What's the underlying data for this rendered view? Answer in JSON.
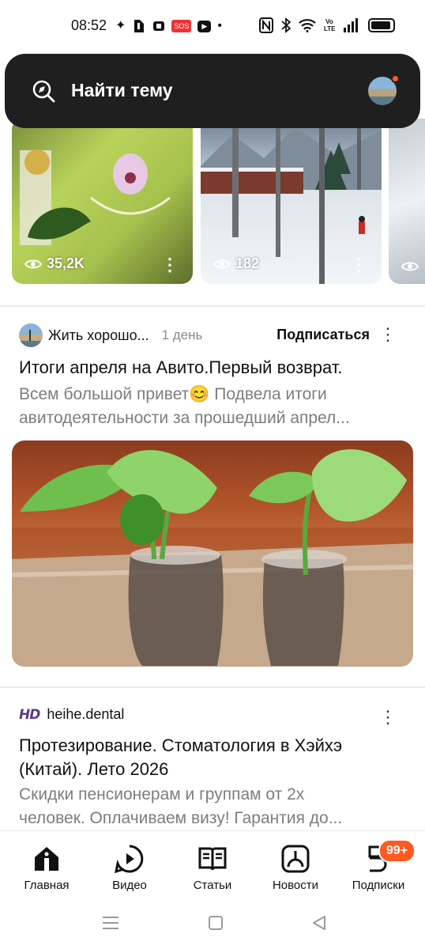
{
  "status_bar": {
    "time": "08:52",
    "left_icons": [
      "sparkle-icon",
      "shield-app-icon",
      "media-icon",
      "sos-icon",
      "youtube-icon",
      "dot-icon"
    ],
    "sos_label": "SOS",
    "right_icons": [
      "nfc-icon",
      "bluetooth-icon",
      "wifi-icon",
      "volte-icon",
      "signal-icon",
      "battery-icon"
    ],
    "volte_label": "Vo LTE"
  },
  "search": {
    "placeholder": "Найти тему",
    "has_notification_dot": true
  },
  "video_strip": {
    "cards": [
      {
        "views": "35,2K"
      },
      {
        "views": "182"
      },
      {
        "views": ""
      }
    ]
  },
  "posts": [
    {
      "channel": "Жить хорошо...",
      "time": "1 день",
      "subscribe_label": "Подписаться",
      "title": "Итоги апреля на Авито.Первый возврат.",
      "description_line1": "Всем большой привет😊 Подвела итоги",
      "description_line2": "авитодеятельности за прошедший апрел..."
    },
    {
      "channel_logo": "HD",
      "channel": "heihe.dental",
      "title_line1": "Протезирование. Стоматология в Хэйхэ",
      "title_line2": "(Китай). Лето 2026",
      "description_line1": "Скидки пенсионерам и группам от 2х",
      "description_line2": "человек. Оплачиваем визу! Гарантия до..."
    }
  ],
  "bottom_nav": {
    "items": [
      {
        "label": "Главная",
        "icon": "home-icon",
        "active": true
      },
      {
        "label": "Видео",
        "icon": "video-icon"
      },
      {
        "label": "Статьи",
        "icon": "articles-icon"
      },
      {
        "label": "Новости",
        "icon": "news-icon"
      },
      {
        "label": "Подписки",
        "icon": "subscriptions-icon",
        "badge": "99+"
      }
    ]
  },
  "colors": {
    "search_bg": "#1f1f1f",
    "accent": "#ff5a1f",
    "muted_text": "#7d7d7d"
  }
}
